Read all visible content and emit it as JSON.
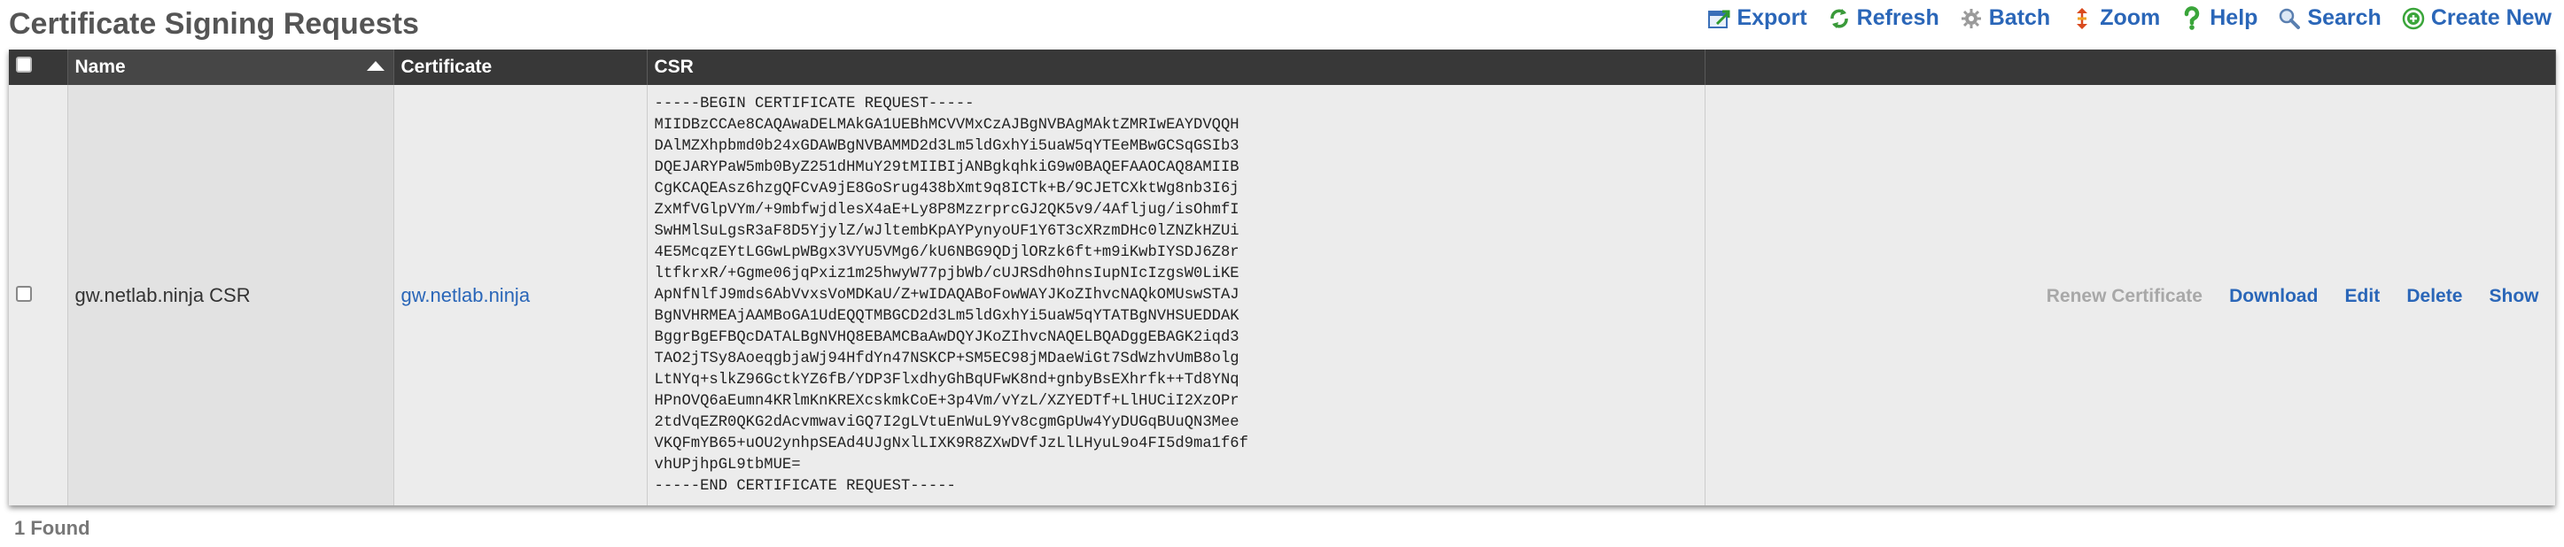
{
  "page": {
    "title": "Certificate Signing Requests",
    "found_label": "1 Found"
  },
  "toolbar": {
    "items": [
      {
        "label": "Export",
        "icon": "export-icon"
      },
      {
        "label": "Refresh",
        "icon": "refresh-icon"
      },
      {
        "label": "Batch",
        "icon": "batch-icon"
      },
      {
        "label": "Zoom",
        "icon": "zoom-icon"
      },
      {
        "label": "Help",
        "icon": "help-icon"
      },
      {
        "label": "Search",
        "icon": "search-icon"
      },
      {
        "label": "Create New",
        "icon": "create-new-icon"
      }
    ]
  },
  "table": {
    "columns": [
      {
        "label": "Name",
        "sorted": "ascending"
      },
      {
        "label": "Certificate"
      },
      {
        "label": "CSR"
      },
      {
        "label": ""
      }
    ],
    "rows": [
      {
        "name": "gw.netlab.ninja CSR",
        "certificate": "gw.netlab.ninja",
        "csr": "-----BEGIN CERTIFICATE REQUEST-----\nMIIDBzCCAe8CAQAwaDELMAkGA1UEBhMCVVMxCzAJBgNVBAgMAktZMRIwEAYDVQQH\nDAlMZXhpbmd0b24xGDAWBgNVBAMMD2d3Lm5ldGxhYi5uaW5qYTEeMBwGCSqGSIb3\nDQEJARYPaW5mb0ByZ251dHMuY29tMIIBIjANBgkqhkiG9w0BAQEFAAOCAQ8AMIIB\nCgKCAQEAsz6hzgQFCvA9jE8GoSrug438bXmt9q8ICTk+B/9CJETCXktWg8nb3I6j\nZxMfVGlpVYm/+9mbfwjdlesX4aE+Ly8P8MzzrprcGJ2QK5v9/4Afljug/isOhmfI\nSwHMlSuLgsR3aF8D5YjylZ/wJltembKpAYPynyoUF1Y6T3cXRzmDHc0lZNZkHZUi\n4E5McqzEYtLGGwLpWBgx3VYU5VMg6/kU6NBG9QDjlORzk6ft+m9iKwbIYSDJ6Z8r\nltfkrxR/+Ggme06jqPxiz1m25hwyW77pjbWb/cUJRSdh0hnsIupNIcIzgsW0LiKE\nApNfNlfJ9mds6AbVvxsVoMDKaU/Z+wIDAQABoFowWAYJKoZIhvcNAQkOMUswSTAJ\nBgNVHRMEAjAAMBoGA1UdEQQTMBGCD2d3Lm5ldGxhYi5uaW5qYTATBgNVHSUEDDAK\nBggrBgEFBQcDATALBgNVHQ8EBAMCBaAwDQYJKoZIhvcNAQELBQADggEBAGK2iqd3\nTAO2jTSy8AoeqgbjaWj94HfdYn47NSKCP+SM5EC98jMDaeWiGt7SdWzhvUmB8olg\nLtNYq+slkZ96GctkYZ6fB/YDP3FlxdhyGhBqUFwK8nd+gnbyBsEXhrfk++Td8YNq\nHPnOVQ6aEumn4KRlmKnKREXcskmkCoE+3p4Vm/vYzL/XZYEDTf+LlHUCiI2XzOPr\n2tdVqEZR0QKG2dAcvmwaviGQ7I2gLVtuEnWuL9Yv8cgmGpUw4YyDUGqBUuQN3Mee\nVKQFmYB65+uOU2ynhpSEAd4UJgNxlLIXK9R8ZXwDVfJzLlLHyuL9o4FI5d9ma1f6f\nvhUPjhpGL9tbMUE=\n-----END CERTIFICATE REQUEST-----",
        "actions": [
          {
            "label": "Renew Certificate",
            "enabled": false
          },
          {
            "label": "Download",
            "enabled": true
          },
          {
            "label": "Edit",
            "enabled": true
          },
          {
            "label": "Delete",
            "enabled": true
          },
          {
            "label": "Show",
            "enabled": true
          }
        ]
      }
    ]
  },
  "colors": {
    "header_bg": "#383838",
    "row_bg": "#ececec",
    "link": "#2a66b8",
    "title": "#555555"
  }
}
